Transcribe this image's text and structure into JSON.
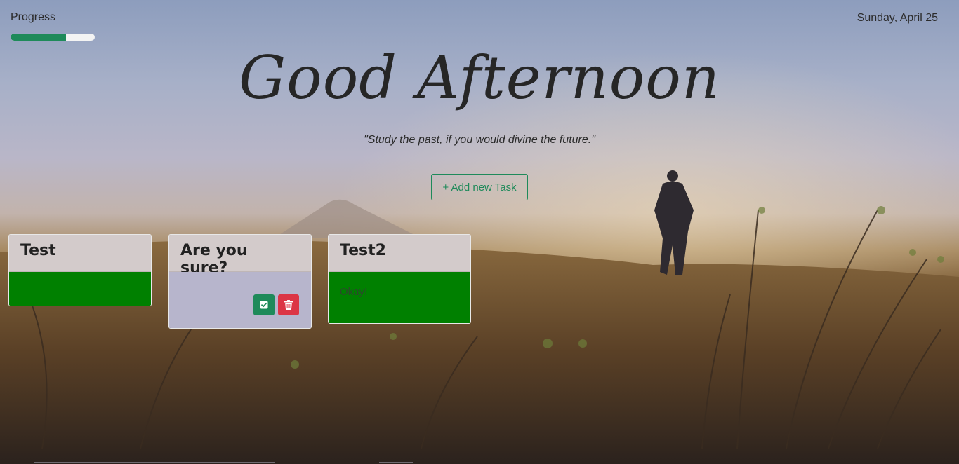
{
  "header": {
    "progress_label": "Progress",
    "progress_value": 0.66,
    "date": "Sunday, April 25"
  },
  "hero": {
    "greeting": "Good Afternoon",
    "quote": "\"Study the past, if you would divine the future.\"",
    "add_task_label": "+ Add new Task"
  },
  "tasks": [
    {
      "title": "Test",
      "body": "",
      "status_color": "#008000"
    },
    {
      "title": "Are you sure?",
      "body": "",
      "status_color": "#b7b5cc"
    },
    {
      "title": "Test2",
      "body": "Okay!",
      "status_color": "#008000"
    }
  ],
  "icons": {
    "confirm": "check-square-icon",
    "delete": "trash-icon"
  },
  "colors": {
    "accent": "#1e8a5a",
    "danger": "#dc3545",
    "done": "#008000"
  }
}
